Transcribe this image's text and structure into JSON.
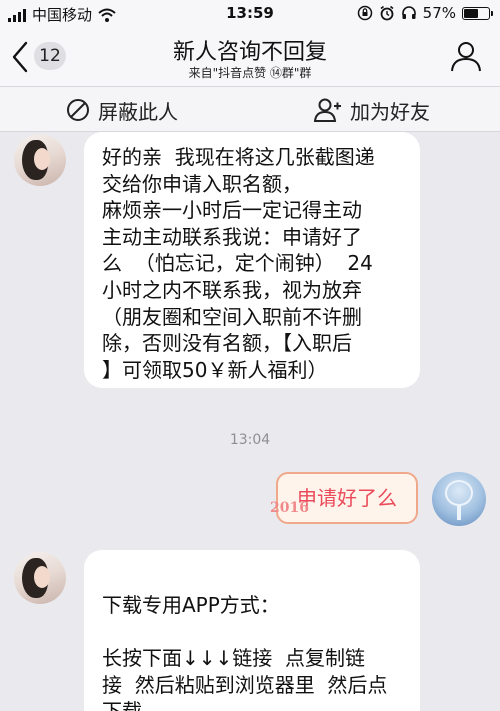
{
  "status_bar": {
    "carrier": "中国移动",
    "time": "13:59",
    "battery_text": "57%",
    "battery_level": 0.57
  },
  "nav": {
    "unread_count": "12",
    "title": "新人咨询不回复",
    "subtitle": "来自\"抖音点赞 ⑭群\"群"
  },
  "actions": {
    "block_label": "屏蔽此人",
    "add_friend_label": "加为好友"
  },
  "messages": [
    {
      "sender": "other",
      "text": "好的亲  我现在将这几张截图递\n交给你申请入职名额，\n麻烦亲一小时后一定记得主动\n主动主动联系我说：申请好了\n么  （怕忘记，定个闹钟）  24\n小时之内不联系我，视为放弃\n（朋友圈和空间入职前不许删\n除，否则没有名额，【入职后\n】可领取50￥新人福利）"
    },
    {
      "sender": "timestamp",
      "text": "13:04"
    },
    {
      "sender": "me",
      "text": "申请好了么",
      "decoration": "2016"
    },
    {
      "sender": "other",
      "text": "下载专用APP方式：\n\n长按下面↓↓↓链接  点复制链\n接  然后粘贴到浏览器里  然后点\n下载"
    }
  ],
  "colors": {
    "background": "#eaeaee",
    "bar_background": "#f7f7f9",
    "my_bubble_text": "#ea4a5a",
    "my_bubble_border": "#f0a88a"
  }
}
